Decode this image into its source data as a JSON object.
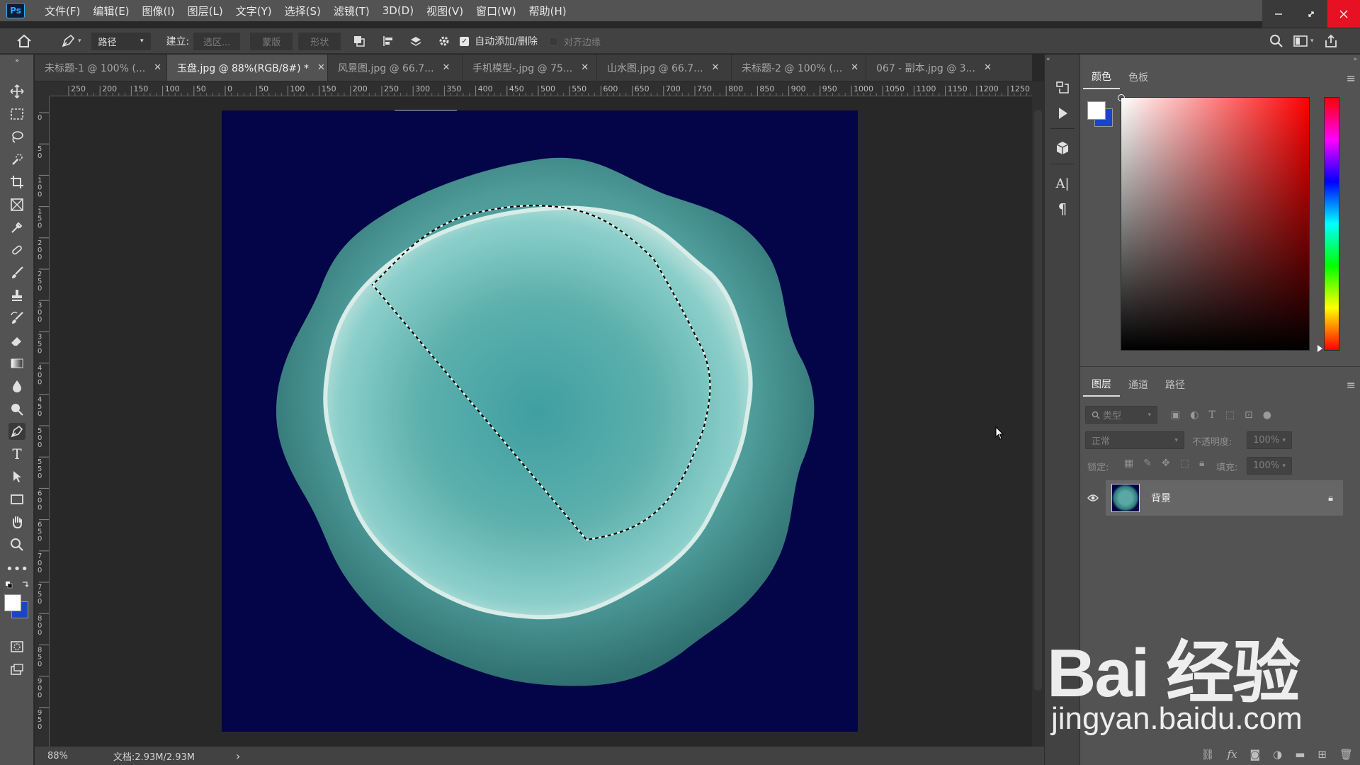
{
  "app": {
    "logo": "Ps",
    "menu": [
      "文件(F)",
      "编辑(E)",
      "图像(I)",
      "图层(L)",
      "文字(Y)",
      "选择(S)",
      "滤镜(T)",
      "3D(D)",
      "视图(V)",
      "窗口(W)",
      "帮助(H)"
    ]
  },
  "options": {
    "mode": "路径",
    "make_label": "建立:",
    "selection_btn": "选区...",
    "mask_btn": "蒙版",
    "shape_btn": "形状",
    "auto_add_delete": "自动添加/删除",
    "align_edges": "对齐边缘",
    "auto_add_checked": true,
    "align_checked": false
  },
  "tabs": [
    {
      "label": "未标题-1 @ 100% (...",
      "active": false
    },
    {
      "label": "玉盘.jpg @ 88%(RGB/8#) *",
      "active": true
    },
    {
      "label": "风景图.jpg @ 66.7...",
      "active": false
    },
    {
      "label": "手机模型-.jpg @ 75...",
      "active": false
    },
    {
      "label": "山水图.jpg @ 66.7...",
      "active": false
    },
    {
      "label": "未标题-2 @ 100% (...",
      "active": false
    },
    {
      "label": "067 - 副本.jpg @ 3...",
      "active": false
    }
  ],
  "ruler": {
    "h_ticks": [
      "250",
      "200",
      "150",
      "100",
      "50",
      "0",
      "50",
      "100",
      "150",
      "200",
      "250",
      "300",
      "350",
      "400",
      "450",
      "500",
      "550",
      "600",
      "650",
      "700",
      "750",
      "800",
      "850",
      "900",
      "950",
      "1000",
      "1050",
      "1100",
      "1150",
      "1200",
      "1250"
    ],
    "v_ticks": [
      "0",
      "50",
      "100",
      "150",
      "200",
      "250",
      "300",
      "350",
      "400",
      "450",
      "500",
      "550",
      "600",
      "650",
      "700",
      "750",
      "800",
      "850",
      "900",
      "950"
    ]
  },
  "status": {
    "zoom": "88%",
    "doc": "文档:2.93M/2.93M",
    "arrow": "›"
  },
  "color_panel": {
    "tabs": [
      "颜色",
      "色板"
    ],
    "active_tab": "颜色",
    "foreground": "#ffffff",
    "background": "#1d43c7"
  },
  "layers_panel": {
    "tabs": [
      "图层",
      "通道",
      "路径"
    ],
    "active_tab": "图层",
    "filter_placeholder": "类型",
    "blend_mode": "正常",
    "opacity_label": "不透明度:",
    "opacity_value": "100%",
    "lock_label": "锁定:",
    "fill_label": "填充:",
    "fill_value": "100%",
    "layers": [
      {
        "name": "背景",
        "visible": true,
        "locked": true
      }
    ]
  },
  "watermark": {
    "main": "Bai 经验",
    "sub": "jingyan.baidu.com"
  },
  "colors": {
    "canvas_bg": "#030548",
    "accent": "#31a8ff",
    "close_red": "#e81123"
  }
}
